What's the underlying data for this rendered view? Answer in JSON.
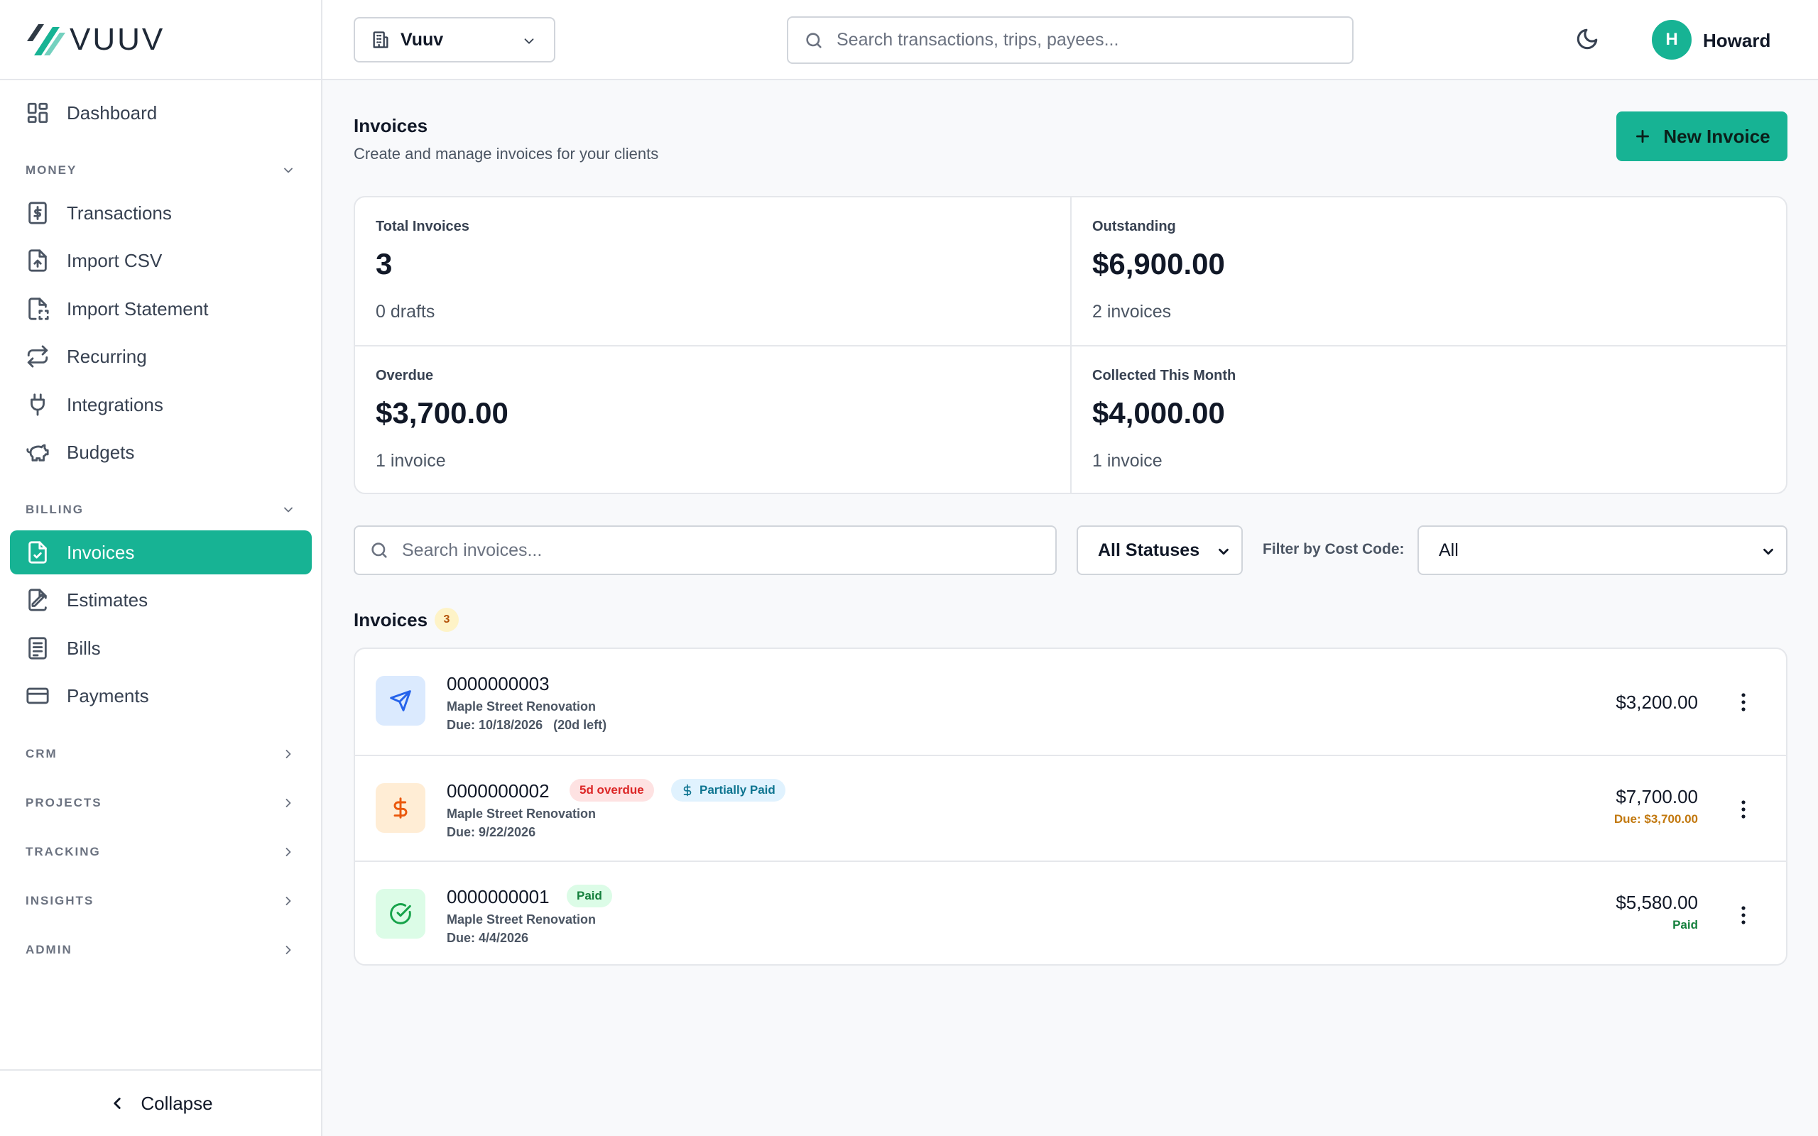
{
  "app": {
    "logo_text": "VUUV"
  },
  "sidebar": {
    "dashboard": "Dashboard",
    "sections": {
      "money": "MONEY",
      "billing": "BILLING",
      "crm": "CRM",
      "projects": "PROJECTS",
      "tracking": "TRACKING",
      "insights": "INSIGHTS",
      "admin": "ADMIN"
    },
    "money_items": [
      "Transactions",
      "Import CSV",
      "Import Statement",
      "Recurring",
      "Integrations",
      "Budgets"
    ],
    "billing_items": [
      "Invoices",
      "Estimates",
      "Bills",
      "Payments"
    ],
    "active_item": "Invoices",
    "collapse_label": "Collapse"
  },
  "topbar": {
    "org_name": "Vuuv",
    "search_placeholder": "Search transactions, trips, payees...",
    "user_initial": "H",
    "user_name": "Howard"
  },
  "page": {
    "title": "Invoices",
    "subtitle": "Create and manage invoices for your clients",
    "new_button": "New Invoice"
  },
  "stats": [
    {
      "label": "Total Invoices",
      "value": "3",
      "sub": "0 drafts"
    },
    {
      "label": "Outstanding",
      "value": "$6,900.00",
      "sub": "2 invoices"
    },
    {
      "label": "Overdue",
      "value": "$3,700.00",
      "sub": "1 invoice"
    },
    {
      "label": "Collected This Month",
      "value": "$4,000.00",
      "sub": "1 invoice"
    }
  ],
  "filters": {
    "search_placeholder": "Search invoices...",
    "status_value": "All Statuses",
    "cost_code_label": "Filter by Cost Code:",
    "cost_code_value": "All"
  },
  "list": {
    "title": "Invoices",
    "count": "3",
    "rows": [
      {
        "number": "0000000003",
        "project": "Maple Street Renovation",
        "due": "Due: 10/18/2026",
        "due_note": "(20d left)",
        "amount": "$3,200.00",
        "icon": "send-icon"
      },
      {
        "number": "0000000002",
        "project": "Maple Street Renovation",
        "due": "Due: 9/22/2026",
        "badge_overdue": "5d overdue",
        "badge_status": "Partially Paid",
        "amount": "$7,700.00",
        "amount_sub": "Due: $3,700.00",
        "icon": "dollar-icon"
      },
      {
        "number": "0000000001",
        "project": "Maple Street Renovation",
        "due": "Due: 4/4/2026",
        "badge_status": "Paid",
        "amount": "$5,580.00",
        "amount_sub": "Paid",
        "icon": "check-circle-icon"
      }
    ]
  },
  "colors": {
    "brand": "#17b394",
    "overdue": "#dc2626",
    "partial": "#0e7490",
    "paid": "#15803d",
    "due_amount": "#c2780e"
  }
}
